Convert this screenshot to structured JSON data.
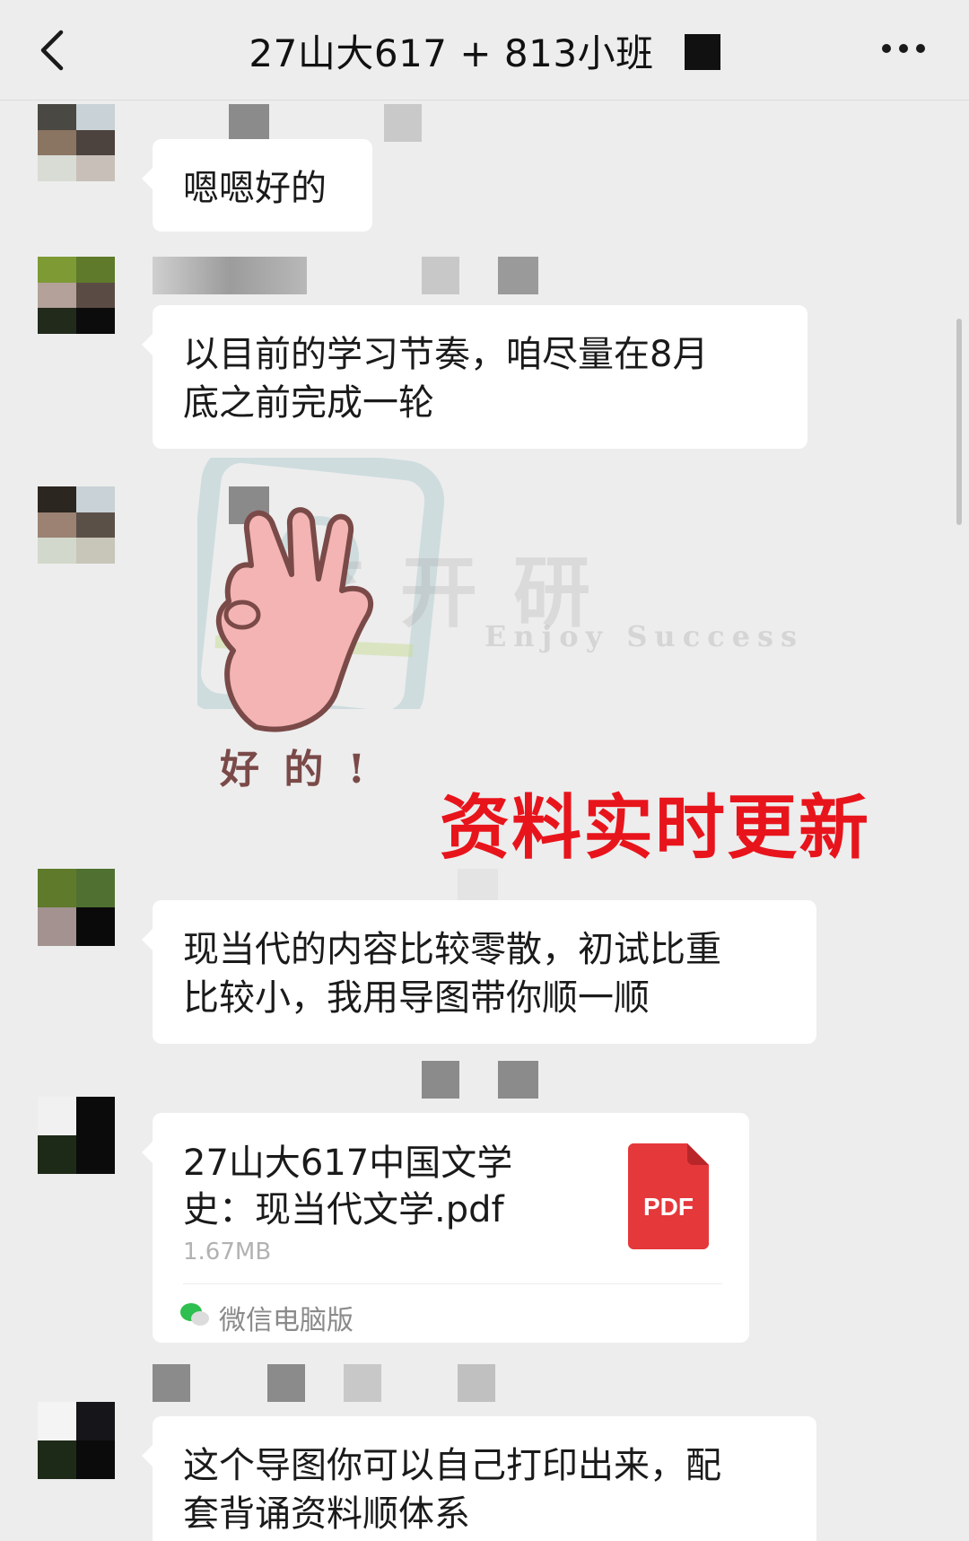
{
  "header": {
    "title": "27山大617 + 813小班"
  },
  "messages": [
    {
      "text": "嗯嗯好的"
    },
    {
      "text": "以目前的学习节奏，咱尽量在8月\n底之前完成一轮"
    },
    {
      "sticker_caption": "好 的 !"
    },
    {
      "text": "现当代的内容比较零散，初试比重\n比较小，我用导图带你顺一顺"
    },
    {
      "file": {
        "name": "27山大617中国文学史：现当代文学.pdf",
        "size": "1.67MB",
        "source": "微信电脑版",
        "icon_label": "PDF"
      }
    },
    {
      "text": "这个导图你可以自己打印出来，配\n套背诵资料顺体系"
    }
  ],
  "overlay": {
    "promo_text": "资料实时更新",
    "watermark_cn": "笑开研",
    "watermark_en": "Enjoy Success"
  },
  "colors": {
    "background": "#ededed",
    "bubble": "#ffffff",
    "promo": "#e8141c",
    "pdf_icon": "#e5383b"
  }
}
